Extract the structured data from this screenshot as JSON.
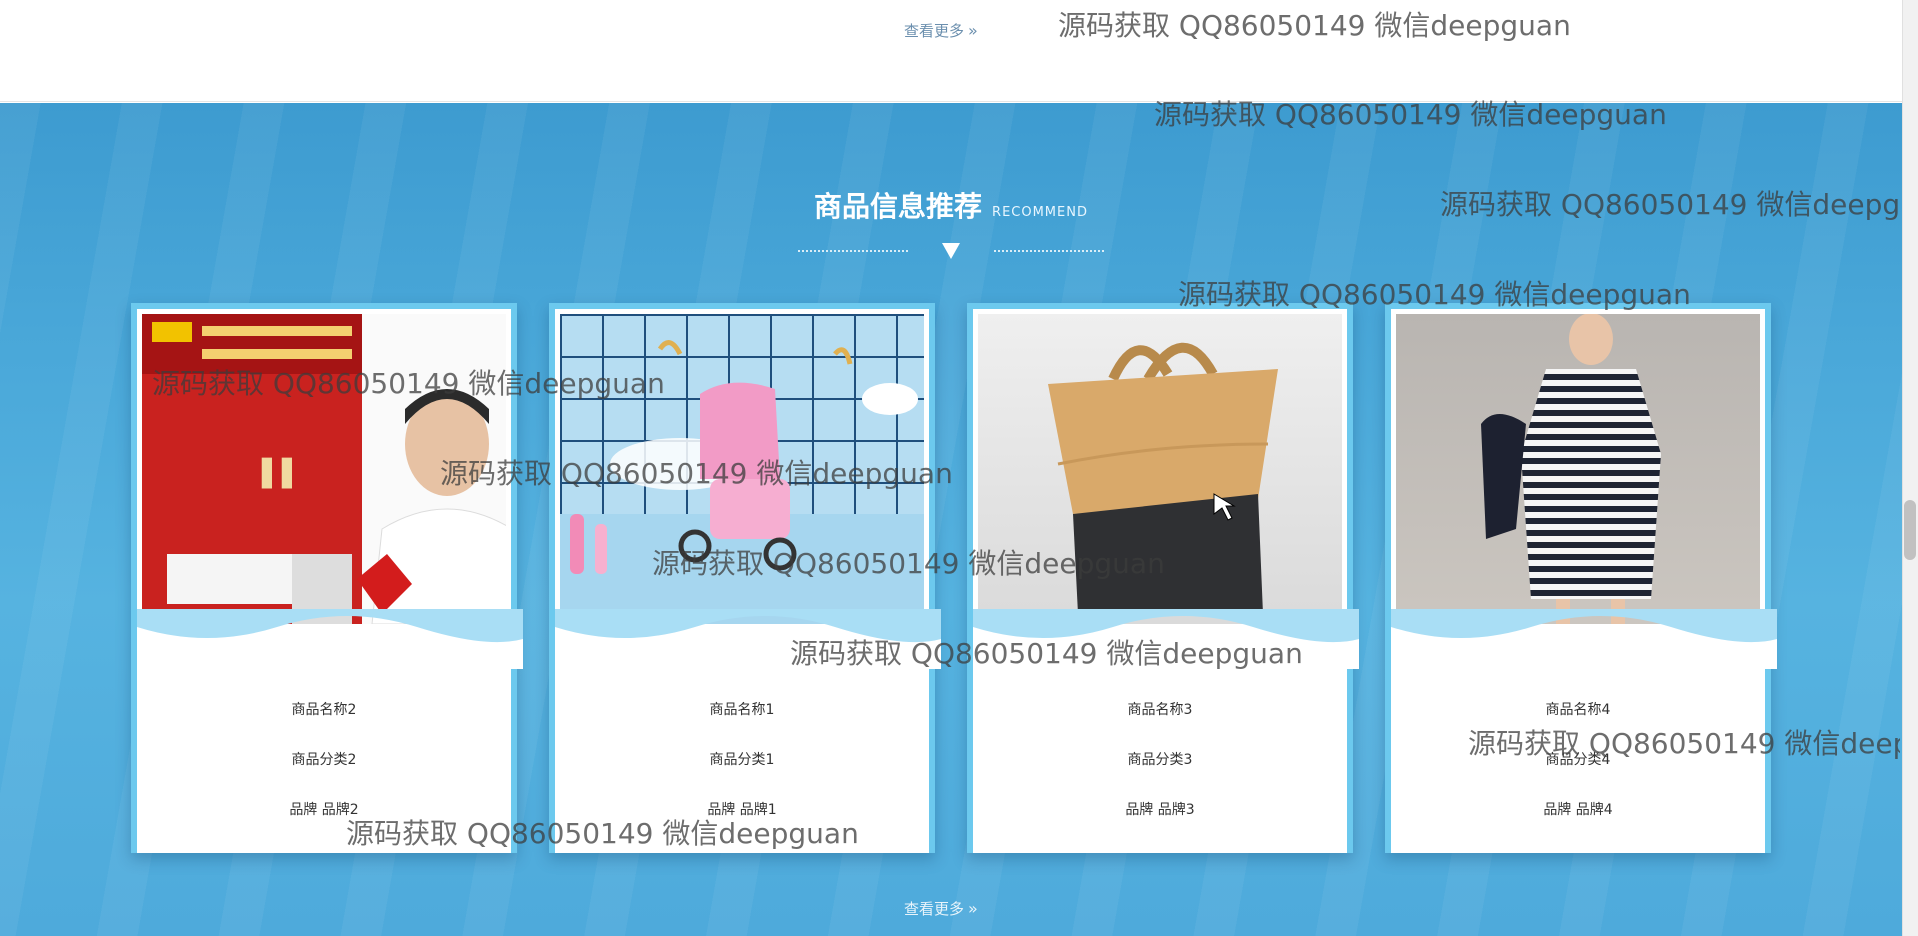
{
  "top": {
    "more_label": "查看更多",
    "more_icon": "double-chevron-right-icon"
  },
  "section": {
    "title": "商品信息推荐",
    "subtitle": "RECOMMEND",
    "more_label": "查看更多",
    "colors": {
      "background": "#4aa8d9",
      "card_border": "#6cc9ee"
    }
  },
  "products": [
    {
      "name": "商品名称2",
      "category": "商品分类2",
      "brand": "品牌 品牌2",
      "image": "book-image"
    },
    {
      "name": "商品名称1",
      "category": "商品分类1",
      "brand": "品牌 品牌1",
      "image": "stroller-image"
    },
    {
      "name": "商品名称3",
      "category": "商品分类3",
      "brand": "品牌 品牌3",
      "image": "bag-image"
    },
    {
      "name": "商品名称4",
      "category": "商品分类4",
      "brand": "品牌 品牌4",
      "image": "dress-image"
    }
  ],
  "watermark": "源码获取 QQ86050149 微信deepguan"
}
